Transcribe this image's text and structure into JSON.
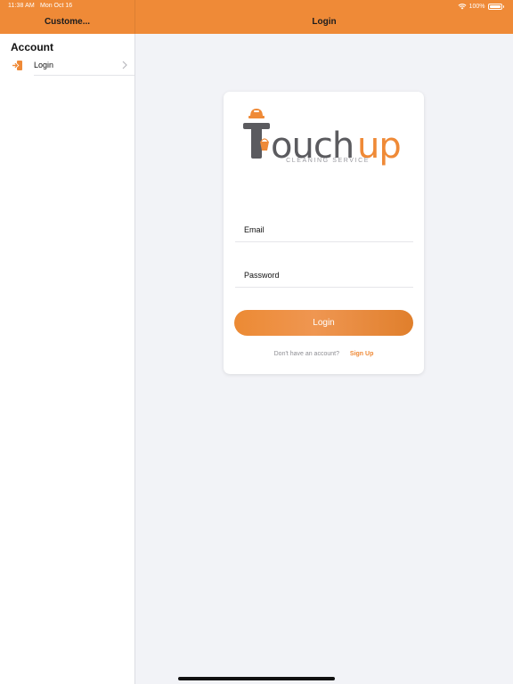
{
  "status_bar": {
    "time": "11:38 AM",
    "date": "Mon Oct 16",
    "battery": "100%",
    "icons": [
      "wifi-icon",
      "battery-icon"
    ]
  },
  "sidebar": {
    "nav_title": "Custome...",
    "section_title": "Account",
    "items": [
      {
        "label": "Login",
        "icon": "login-icon"
      }
    ]
  },
  "main": {
    "nav_title": "Login",
    "logo": {
      "brand": "Touchup",
      "tagline": "CLEANING SERVICE"
    },
    "form": {
      "email_placeholder": "Email",
      "password_placeholder": "Password",
      "submit_label": "Login",
      "signup_prompt": "Don't have an account?",
      "signup_link": "Sign Up"
    }
  },
  "colors": {
    "accent": "#ef8a37",
    "logo_gray": "#5b5b5f",
    "background": "#f2f3f7"
  }
}
